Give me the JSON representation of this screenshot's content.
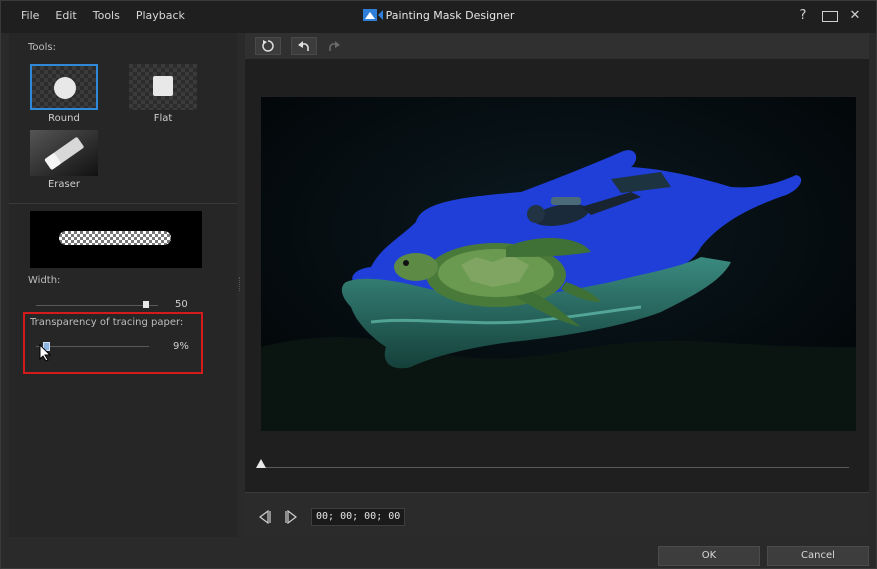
{
  "window": {
    "title": "Painting Mask Designer",
    "menu": [
      "File",
      "Edit",
      "Tools",
      "Playback"
    ],
    "controls": {
      "help": "?",
      "close": "✕"
    }
  },
  "left_panel": {
    "tools_label": "Tools:",
    "tools": [
      {
        "name": "Round",
        "icon": "round-brush-icon",
        "selected": true
      },
      {
        "name": "Flat",
        "icon": "flat-brush-icon",
        "selected": false
      },
      {
        "name": "Eraser",
        "icon": "eraser-icon",
        "selected": false
      }
    ],
    "width_label": "Width:",
    "width_value": "50",
    "transparency_label": "Transparency of tracing paper:",
    "transparency_value": "9%",
    "width_fraction": 0.9,
    "transparency_fraction": 0.09
  },
  "toolbar": {
    "icons": [
      "reset-icon",
      "undo-icon",
      "redo-icon"
    ]
  },
  "playback": {
    "timecode": "00; 00; 00; 00",
    "position_fraction": 0.0
  },
  "buttons": {
    "ok": "OK",
    "cancel": "Cancel"
  },
  "colors": {
    "selection": "#2f88d8",
    "highlight": "#d41b1b",
    "mask": "#1f3fd8"
  }
}
